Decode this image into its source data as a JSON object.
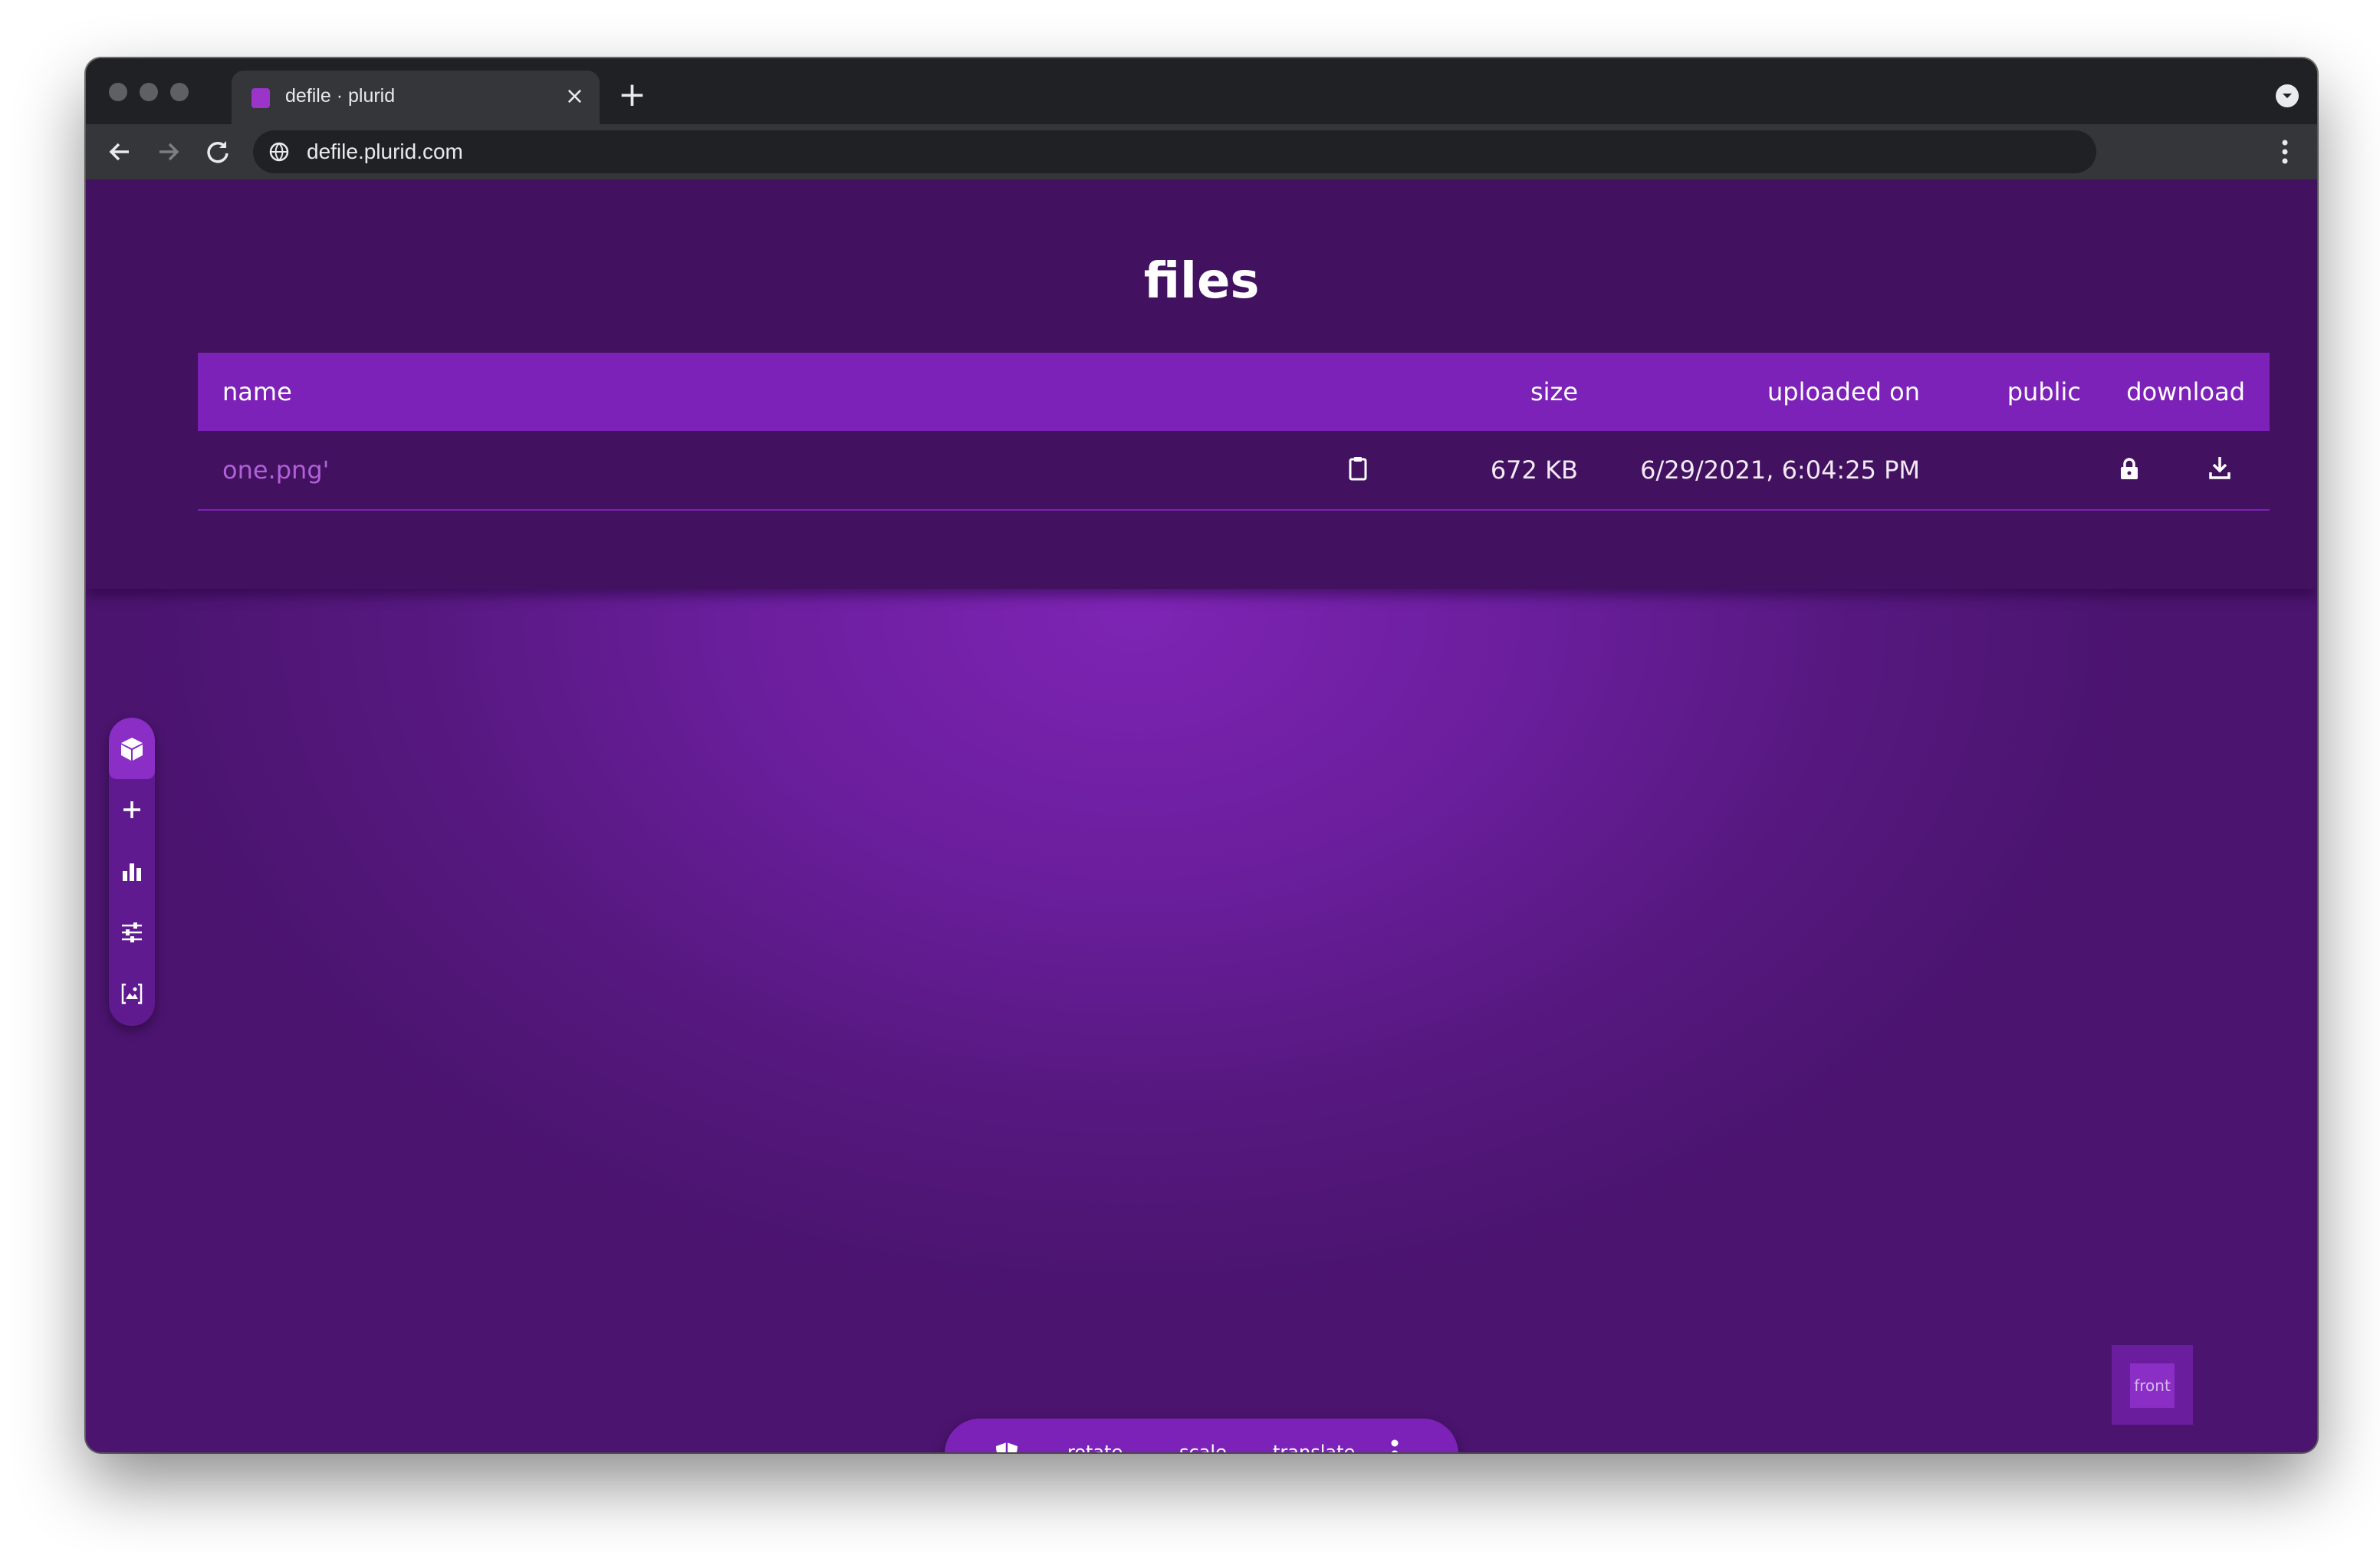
{
  "browser": {
    "tab_title": "defile · plurid",
    "tab_close": "×",
    "new_tab": "+",
    "url": "defile.plurid.com"
  },
  "page": {
    "title": "files",
    "table": {
      "headers": {
        "name": "name",
        "size": "size",
        "uploaded_on": "uploaded on",
        "public": "public",
        "download": "download"
      },
      "rows": [
        {
          "name": "one.png'",
          "size": "672 KB",
          "uploaded_on": "6/29/2021, 6:04:25 PM",
          "public_icon": "lock-icon",
          "download_icon": "download-icon",
          "copy_icon": "clipboard-icon"
        }
      ]
    }
  },
  "side_toolbar": {
    "items": [
      "cube-icon",
      "plus-icon",
      "bar-chart-icon",
      "sliders-icon",
      "image-scan-icon"
    ]
  },
  "bottom_toolbar": {
    "rotate": "rotate",
    "scale": "scale",
    "translate": "translate"
  },
  "view_cube": {
    "label": "front"
  },
  "colors": {
    "page_background": "#56187f",
    "files_section": "#42115f",
    "accent": "#7d22b8",
    "link": "#b061d8"
  }
}
